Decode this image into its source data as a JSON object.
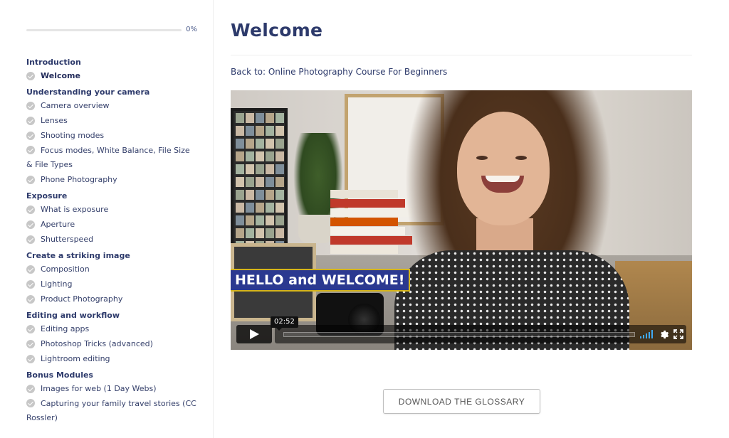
{
  "sidebar": {
    "progress": {
      "percent": 0,
      "label": "0%"
    },
    "sections": [
      {
        "title": "Introduction",
        "lessons": [
          "Welcome"
        ]
      },
      {
        "title": "Understanding your camera",
        "lessons": [
          "Camera overview",
          "Lenses",
          "Shooting modes",
          "Focus modes, White Balance, File Size & File Types",
          "Phone Photography"
        ]
      },
      {
        "title": "Exposure",
        "lessons": [
          "What is exposure",
          "Aperture",
          "Shutterspeed"
        ]
      },
      {
        "title": "Create a striking image",
        "lessons": [
          "Composition",
          "Lighting",
          "Product Photography"
        ]
      },
      {
        "title": "Editing and workflow",
        "lessons": [
          "Editing apps",
          "Photoshop Tricks (advanced)",
          "Lightroom editing"
        ]
      },
      {
        "title": "Bonus Modules",
        "lessons": [
          "Images for web (1 Day Webs)",
          "Capturing your family travel stories (CC Rossler)"
        ]
      }
    ],
    "active_lesson": "Welcome"
  },
  "main": {
    "title": "Welcome",
    "back_link": "Back to: Online Photography Course For Beginners",
    "video": {
      "banner": "HELLO and WELCOME!",
      "timecode": "02:52",
      "progress": 0
    },
    "download_label": "DOWNLOAD THE GLOSSARY"
  },
  "colors": {
    "accent": "#2b3990",
    "banner_border": "#d4b41b",
    "volume": "#3fa9f5"
  }
}
